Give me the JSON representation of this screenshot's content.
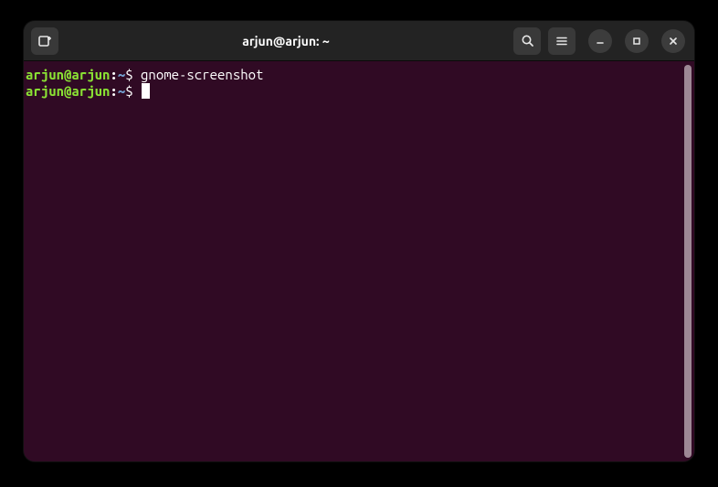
{
  "window": {
    "title": "arjun@arjun: ~"
  },
  "icons": {
    "newtab": "new-tab-icon",
    "search": "search-icon",
    "menu": "hamburger-menu-icon",
    "minimize": "minimize-icon",
    "maximize": "maximize-icon",
    "close": "close-icon"
  },
  "prompt": {
    "user_host": "arjun@arjun",
    "separator": ":",
    "path": "~",
    "symbol": "$"
  },
  "lines": [
    {
      "command": "gnome-screenshot"
    },
    {
      "command": "",
      "cursor": true
    }
  ],
  "colors": {
    "bg": "#300a24",
    "user": "#8ae234",
    "path": "#729fcf",
    "text": "#ffffff"
  }
}
